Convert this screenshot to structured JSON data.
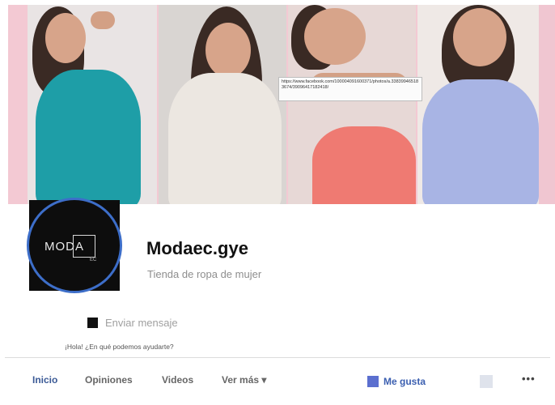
{
  "cover": {
    "url_tooltip": "https://www.facebook.com/100004091600371/photos/a.338399465183674/39096417182418/"
  },
  "profile": {
    "avatar_text": "MODA",
    "avatar_subtext": "EC",
    "name": "Modaec.gye",
    "category": "Tienda de ropa de mujer"
  },
  "actions": {
    "message_label": "Enviar mensaje",
    "greeting": "¡Hola! ¿En qué podemos ayudarte?"
  },
  "tabs": [
    {
      "label": "Inicio"
    },
    {
      "label": "Opiniones"
    },
    {
      "label": "Videos"
    },
    {
      "label": "Ver más ▾"
    }
  ],
  "like": {
    "label": "Me gusta"
  },
  "more": {
    "label": "•••"
  },
  "colors": {
    "accent": "#3b5a96",
    "ring": "#3d6ec9",
    "cover_pink": "#f3c9d3"
  }
}
